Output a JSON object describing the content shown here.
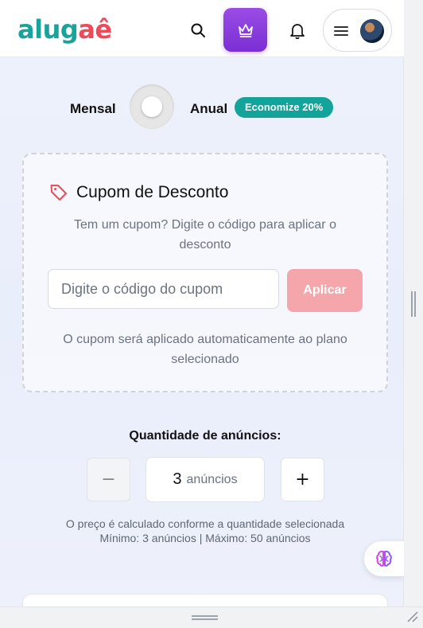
{
  "header": {
    "logo": {
      "part1": "alug",
      "part2": "aê"
    },
    "search_icon": "search-icon",
    "premium_icon": "crown-icon",
    "notification_icon": "bell-icon",
    "menu_icon": "hamburger-menu-icon",
    "avatar": "user-avatar"
  },
  "billing": {
    "monthly_label": "Mensal",
    "annual_label": "Anual",
    "savings_badge": "Economize 20%",
    "toggle_state": "monthly"
  },
  "coupon": {
    "title": "Cupom de Desconto",
    "icon": "tag-icon",
    "description": "Tem um cupom? Digite o código para aplicar o desconto",
    "input_placeholder": "Digite o código do cupom",
    "apply_label": "Aplicar",
    "note": "O cupom será aplicado automaticamente ao plano selecionado"
  },
  "quantity": {
    "label": "Quantidade de anúncios:",
    "decrement_symbol": "−",
    "increment_symbol": "+",
    "value": "3",
    "unit": "anúncios",
    "note_line1": "O preço é calculado conforme a quantidade selecionada",
    "note_line2": "Mínimo: 3 anúncios | Máximo: 50 anúncios"
  },
  "assistant": {
    "icon": "brain-icon"
  },
  "colors": {
    "brand_teal": "#1aa39b",
    "brand_red": "#ef4a5a",
    "premium_purple": "#8a3fe0",
    "badge_teal": "#12a39a",
    "apply_button": "#f4a6aa"
  }
}
